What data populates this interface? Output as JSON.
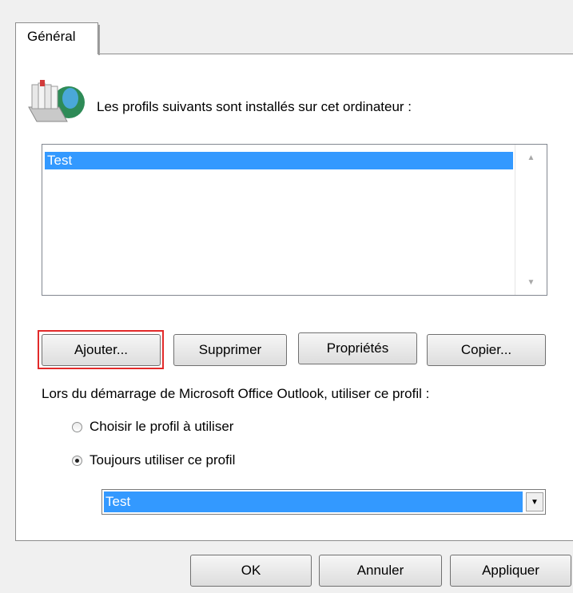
{
  "tabs": [
    {
      "label": "Général"
    }
  ],
  "intro_text": "Les profils suivants sont installés sur cet ordinateur :",
  "profiles": [
    {
      "name": "Test",
      "selected": true
    }
  ],
  "buttons": {
    "add": "Ajouter...",
    "delete": "Supprimer",
    "properties": "Propriétés",
    "copy": "Copier..."
  },
  "startup_label": "Lors du démarrage de Microsoft Office Outlook, utiliser ce profil :",
  "radio_options": [
    {
      "label": "Choisir le profil à utiliser",
      "checked": false
    },
    {
      "label": "Toujours utiliser ce profil",
      "checked": true
    }
  ],
  "default_profile": "Test",
  "footer": {
    "ok": "OK",
    "cancel": "Annuler",
    "apply": "Appliquer"
  },
  "colors": {
    "selection": "#3399ff",
    "highlight_border": "#e22a2a"
  }
}
